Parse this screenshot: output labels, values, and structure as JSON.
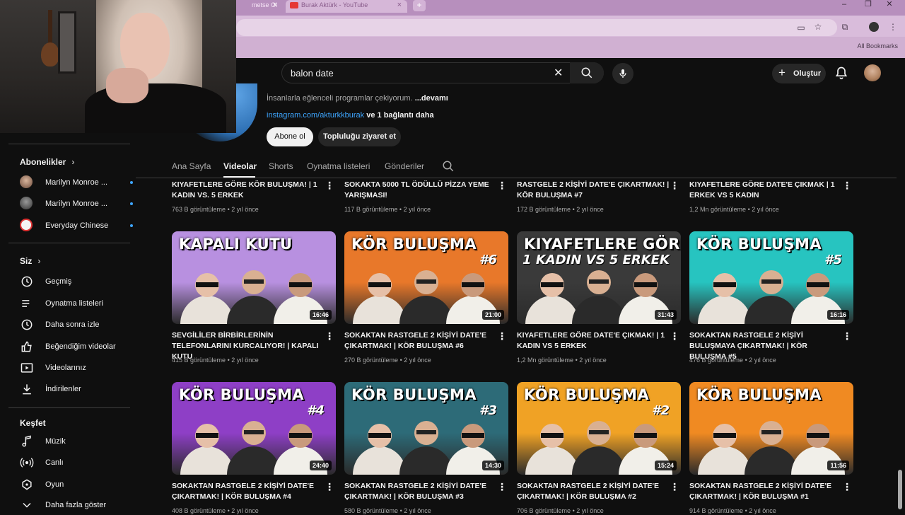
{
  "browser": {
    "tabs": [
      {
        "label": "metse Ol",
        "close": "×"
      },
      {
        "label": "Burak Aktürk - YouTube",
        "close": "×"
      }
    ],
    "new_tab": "+",
    "window_controls": [
      "–",
      "❐",
      "✕"
    ],
    "bookmarks_label": "All Bookmarks"
  },
  "topbar": {
    "search_value": "balon date",
    "create_label": "Oluştur"
  },
  "channel": {
    "description": "İnsanlarla eğlenceli programlar çekiyorum.",
    "description_more": "...devamı",
    "link": "instagram.com/akturkkburak",
    "link_more": "ve 1 bağlantı daha",
    "subscribe_label": "Abone ol",
    "community_label": "Topluluğu ziyaret et",
    "tabs": [
      "Ana Sayfa",
      "Videolar",
      "Shorts",
      "Oynatma listeleri",
      "Gönderiler"
    ],
    "active_tab": "Videolar"
  },
  "sidebar": {
    "subscriptions_heading": "Abonelikler",
    "subscriptions": [
      {
        "label": "Marilyn Monroe ...",
        "avatar_color": "#8a6a5a"
      },
      {
        "label": "Marilyn Monroe ...",
        "avatar_color": "#555555"
      },
      {
        "label": "Everyday Chinese",
        "avatar_color": "#f4f4f4"
      }
    ],
    "you_heading": "Siz",
    "you_items": [
      {
        "label": "Geçmiş",
        "icon": "history-icon"
      },
      {
        "label": "Oynatma listeleri",
        "icon": "playlist-icon"
      },
      {
        "label": "Daha sonra izle",
        "icon": "clock-icon"
      },
      {
        "label": "Beğendiğim videolar",
        "icon": "thumbs-up-icon"
      },
      {
        "label": "Videolarınız",
        "icon": "video-icon"
      },
      {
        "label": "İndirilenler",
        "icon": "download-icon"
      }
    ],
    "explore_heading": "Keşfet",
    "explore_items": [
      {
        "label": "Müzik",
        "icon": "music-icon"
      },
      {
        "label": "Canlı",
        "icon": "live-icon"
      },
      {
        "label": "Oyun",
        "icon": "gaming-icon"
      },
      {
        "label": "Daha fazla göster",
        "icon": "chevron-down-icon"
      }
    ]
  },
  "videos": {
    "row0": [
      {
        "title": "KIYAFETLERE GÖRE KÖR BULUŞMA! | 1 KADIN VS. 5 ERKEK",
        "views": "763 B görüntüleme",
        "age": "2 yıl önce"
      },
      {
        "title": "SOKAKTA 5000 TL ÖDÜLLÜ PİZZA YEME YARIŞMASI!",
        "views": "117 B görüntüleme",
        "age": "2 yıl önce"
      },
      {
        "title": "RASTGELE 2 KİŞİYİ DATE'E ÇIKARTMAK! | KÖR BULUŞMA #7",
        "views": "172 B görüntüleme",
        "age": "2 yıl önce"
      },
      {
        "title": "KIYAFETLERE GÖRE DATE'E ÇIKMAK | 1 ERKEK VS 5 KADIN",
        "views": "1,2 Mn görüntüleme",
        "age": "2 yıl önce"
      }
    ],
    "row1": [
      {
        "thumb_text": "KAPALI KUTU",
        "thumb_num": "",
        "bg": "#b890e0",
        "duration": "16:46",
        "title": "SEVGİLİLER BİRBİRLERİNİN TELEFONLARINI KURCALIYOR! | KAPALI KUTU",
        "views": "415 B görüntüleme",
        "age": "2 yıl önce"
      },
      {
        "thumb_text": "KÖR BULUŞMA",
        "thumb_num": "#6",
        "bg": "#e8782a",
        "duration": "21:00",
        "title": "SOKAKTAN RASTGELE 2 KİŞİYİ DATE'E ÇIKARTMAK! | KÖR BULUŞMA #6",
        "views": "270 B görüntüleme",
        "age": "2 yıl önce"
      },
      {
        "thumb_text": "KIYAFETLERE GÖRE DATE",
        "thumb_num": "1 KADIN VS 5 ERKEK",
        "bg": "#3a3a3a",
        "duration": "31:43",
        "title": "KIYAFETLERE GÖRE DATE'E ÇIKMAK! | 1 KADIN VS 5 ERKEK",
        "views": "1,2 Mn görüntüleme",
        "age": "2 yıl önce"
      },
      {
        "thumb_text": "KÖR BULUŞMA",
        "thumb_num": "#5",
        "bg": "#27c4c0",
        "duration": "16:16",
        "title": "SOKAKTAN RASTGELE 2 KİŞİYİ BULUŞMAYA ÇIKARTMAK! | KÖR BULUŞMA #5",
        "views": "476 B görüntüleme",
        "age": "2 yıl önce"
      }
    ],
    "row2": [
      {
        "thumb_text": "KÖR BULUŞMA",
        "thumb_num": "#4",
        "bg": "#8e3fc6",
        "duration": "24:40",
        "title": "SOKAKTAN RASTGELE 2 KİŞİYİ DATE'E ÇIKARTMAK! | KÖR BULUŞMA #4",
        "views": "408 B görüntüleme",
        "age": "2 yıl önce"
      },
      {
        "thumb_text": "KÖR BULUŞMA",
        "thumb_num": "#3",
        "bg": "#2d6b78",
        "duration": "14:30",
        "title": "SOKAKTAN RASTGELE 2 KİŞİYİ DATE'E ÇIKARTMAK! | KÖR BULUŞMA #3",
        "views": "580 B görüntüleme",
        "age": "2 yıl önce"
      },
      {
        "thumb_text": "KÖR BULUŞMA",
        "thumb_num": "#2",
        "bg": "#f0a225",
        "duration": "15:24",
        "title": "SOKAKTAN RASTGELE 2 KİŞİYİ DATE'E ÇIKARTMAK! | KÖR BULUŞMA #2",
        "views": "706 B görüntüleme",
        "age": "2 yıl önce"
      },
      {
        "thumb_text": "KÖR BULUŞMA",
        "thumb_num": "",
        "bg": "#f08a22",
        "duration": "11:56",
        "title": "SOKAKTAN RASTGELE 2 KİŞİYİ DATE'E ÇIKARTMAK! | KÖR BULUŞMA #1",
        "views": "914 B görüntüleme",
        "age": "2 yıl önce"
      }
    ],
    "separator": "•",
    "menu_glyph": "⋮"
  },
  "colors": {
    "background": "#0f0f0f",
    "accent_link": "#3ea6ff",
    "browser_frame": "#c9a6cb"
  }
}
